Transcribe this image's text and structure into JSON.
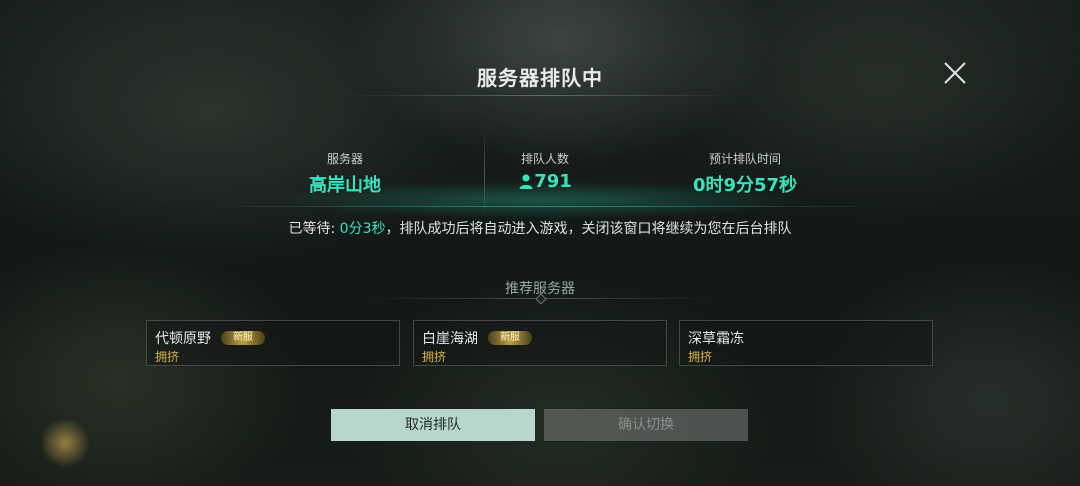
{
  "dialog": {
    "title": "服务器排队中"
  },
  "stats": {
    "server": {
      "label": "服务器",
      "value": "高岸山地"
    },
    "queue": {
      "label": "排队人数",
      "value": "791",
      "icon": "person-icon"
    },
    "eta": {
      "label": "预计排队时间",
      "value": "0时9分57秒"
    }
  },
  "waiting": {
    "prefix": "已等待: ",
    "elapsed": "0分3秒",
    "suffix": "，排队成功后将自动进入游戏，关闭该窗口将继续为您在后台排队"
  },
  "recommended": {
    "title": "推荐服务器",
    "servers": [
      {
        "name": "代顿原野",
        "badge": "新服",
        "status": "拥挤"
      },
      {
        "name": "白崖海湖",
        "badge": "新服",
        "status": "拥挤"
      },
      {
        "name": "深草霜冻",
        "status": "拥挤"
      }
    ]
  },
  "buttons": {
    "cancel": "取消排队",
    "confirm": "确认切换"
  },
  "colors": {
    "accent": "#39e2bd",
    "status_busy": "#d8b24a",
    "cancel_bg": "#b7d6cc"
  }
}
